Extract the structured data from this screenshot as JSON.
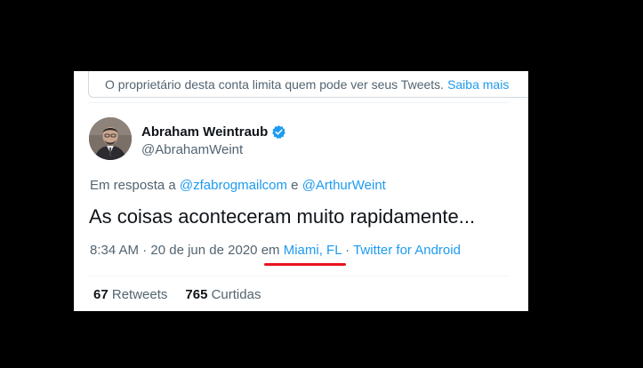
{
  "notice": {
    "text": "O proprietário desta conta limita quem pode ver seus Tweets.",
    "link": "Saiba mais"
  },
  "author": {
    "name": "Abraham Weintraub",
    "handle": "@AbrahamWeint",
    "verified": true
  },
  "reply": {
    "prefix": "Em resposta a",
    "mention1": "@zfabrogmailcom",
    "joiner": "e",
    "mention2": "@ArthurWeint"
  },
  "tweet": {
    "text": "As coisas aconteceram muito rapidamente..."
  },
  "meta": {
    "time": "8:34 AM",
    "sep1": "·",
    "date": "20 de jun de 2020",
    "em": "em",
    "location": "Miami, FL",
    "sep2": "·",
    "source": "Twitter for Android"
  },
  "stats": {
    "retweets_count": "67",
    "retweets_label": "Retweets",
    "likes_count": "765",
    "likes_label": "Curtidas"
  },
  "colors": {
    "link": "#1d9bf0",
    "text": "#0f1419",
    "muted": "#536471",
    "highlight_underline": "#e8141b"
  }
}
